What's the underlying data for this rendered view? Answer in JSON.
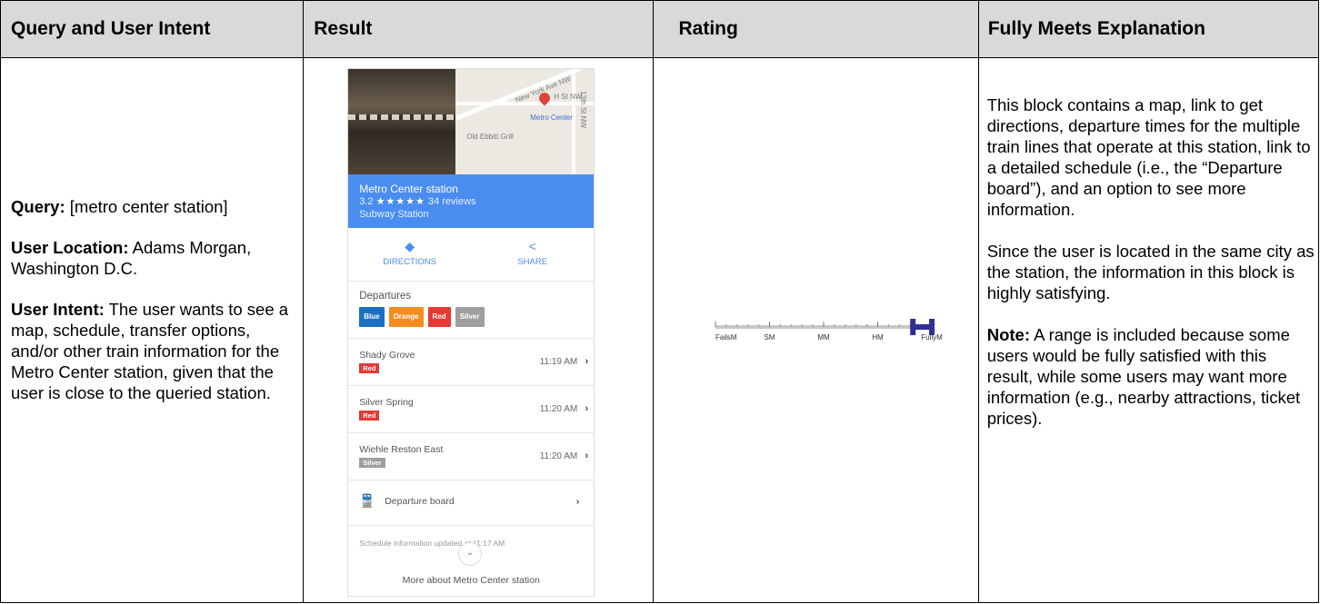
{
  "headers": [
    "Query and User Intent",
    "Result",
    "Rating",
    "Fully Meets Explanation"
  ],
  "intent": {
    "query_label": "Query:",
    "query_value": " [metro center station]",
    "location_label": "User Location:",
    "location_value": " Adams Morgan, Washington D.C.",
    "intent_label": "User Intent:",
    "intent_value": " The user wants to see a map, schedule, transfer options, and/or other train information for the Metro Center station, given that the user is close to the queried station."
  },
  "card": {
    "map_labels": [
      "New York Ave NW",
      "H St NW",
      "Metro Center",
      "Old Ebbitt Grill",
      "13th St NW"
    ],
    "name": "Metro Center station",
    "rating": "3.2",
    "stars": "★★★★★",
    "reviews": "34 reviews",
    "type": "Subway Station",
    "directions": "DIRECTIONS",
    "share": "SHARE",
    "departures_title": "Departures",
    "lines": [
      {
        "label": "Blue",
        "color": "#1a6fc1"
      },
      {
        "label": "Orange",
        "color": "#f68c1f"
      },
      {
        "label": "Red",
        "color": "#e53935"
      },
      {
        "label": "Silver",
        "color": "#9e9e9e"
      }
    ],
    "departures": [
      {
        "dest": "Shady Grove",
        "line": "Red",
        "color": "#e53935",
        "time": "11:19 AM"
      },
      {
        "dest": "Silver Spring",
        "line": "Red",
        "color": "#e53935",
        "time": "11:20 AM"
      },
      {
        "dest": "Wiehle Reston East",
        "line": "Silver",
        "color": "#9e9e9e",
        "time": "11:20 AM"
      }
    ],
    "board_label": "Departure board",
    "schedule_note": "Schedule information updated at 11:17 AM",
    "more_label": "More about Metro Center station"
  },
  "rating_scale": {
    "labels": [
      "FailsM",
      "SM",
      "MM",
      "HM",
      "FullyM"
    ],
    "range_from": "HM",
    "range_to": "FullyM",
    "bar_color": "#2e3192"
  },
  "explanation": [
    "This block contains a map, link to get directions, departure times for the multiple train lines that operate at this station, link to a detailed schedule (i.e., the “Departure board”), and an option to see more information.",
    "Since the user is located in the same city as the station, the information in this block is highly satisfying."
  ],
  "note": {
    "label": "Note:",
    "text": " A range is included because some users would be fully satisfied with this result, while some users may want more information (e.g., nearby attractions, ticket prices)."
  }
}
